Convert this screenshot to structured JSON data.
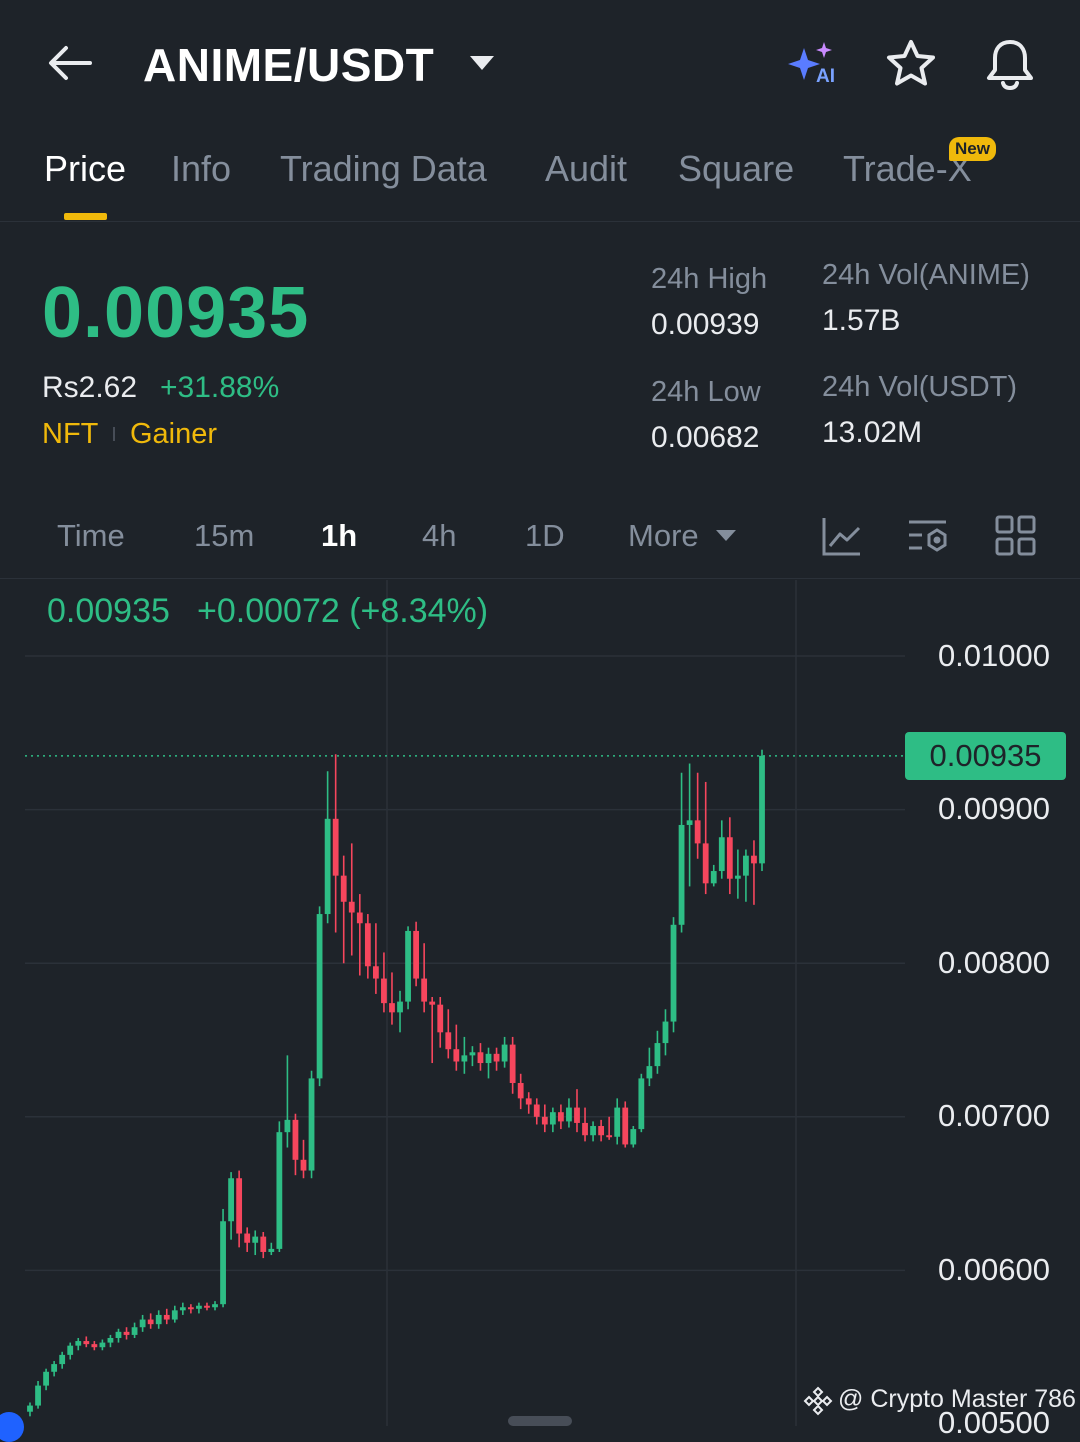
{
  "header": {
    "pair": "ANIME/USDT",
    "icons": [
      "back-arrow-icon",
      "ai-sparkle-icon",
      "star-icon",
      "bell-icon"
    ],
    "ai_badge": "AI"
  },
  "tabs": [
    {
      "label": "Price",
      "active": true
    },
    {
      "label": "Info"
    },
    {
      "label": "Trading Data"
    },
    {
      "label": "Audit"
    },
    {
      "label": "Square"
    },
    {
      "label": "Trade-X",
      "badge": "New"
    }
  ],
  "price": {
    "last": "0.00935",
    "fiat": "Rs2.62",
    "change": "+31.88%",
    "tags": [
      "NFT",
      "Gainer"
    ]
  },
  "stats": {
    "high_label": "24h High",
    "high": "0.00939",
    "low_label": "24h Low",
    "low": "0.00682",
    "vol_base_label": "24h Vol(ANIME)",
    "vol_base": "1.57B",
    "vol_quote_label": "24h Vol(USDT)",
    "vol_quote": "13.02M"
  },
  "intervals": {
    "items": [
      "Time",
      "15m",
      "1h",
      "4h",
      "1D",
      "More"
    ],
    "active": "1h",
    "icons": [
      "chart-indicator-icon",
      "chart-settings-icon",
      "grid-layout-icon"
    ]
  },
  "chart_head": {
    "price": "0.00935",
    "change": "+0.00072 (+8.34%)"
  },
  "watermark": "@ Crypto Master 786",
  "colors": {
    "up": "#2ebd85",
    "down": "#f6465d",
    "accent": "#f0b90b",
    "bg": "#1e2329"
  },
  "chart_data": {
    "type": "candlestick",
    "interval": "1h",
    "y_ticks": [
      "0.01000",
      "0.00900",
      "0.00800",
      "0.00700",
      "0.00600",
      "0.00500"
    ],
    "ylim": [
      0.005,
      0.01
    ],
    "last_price": "0.00935",
    "candles": [
      [
        0.00508,
        0.00512,
        0.00505,
        0.00514
      ],
      [
        0.00512,
        0.00525,
        0.0051,
        0.00528
      ],
      [
        0.00525,
        0.00534,
        0.00522,
        0.00536
      ],
      [
        0.00534,
        0.00539,
        0.00531,
        0.00541
      ],
      [
        0.00539,
        0.00545,
        0.00536,
        0.00547
      ],
      [
        0.00545,
        0.00551,
        0.00542,
        0.00553
      ],
      [
        0.00551,
        0.00554,
        0.00548,
        0.00556
      ],
      [
        0.00554,
        0.00552,
        0.0055,
        0.00557
      ],
      [
        0.00552,
        0.0055,
        0.00548,
        0.00554
      ],
      [
        0.0055,
        0.00553,
        0.00548,
        0.00555
      ],
      [
        0.00553,
        0.00556,
        0.0055,
        0.00558
      ],
      [
        0.00556,
        0.0056,
        0.00553,
        0.00562
      ],
      [
        0.0056,
        0.00558,
        0.00555,
        0.00563
      ],
      [
        0.00558,
        0.00563,
        0.00556,
        0.00566
      ],
      [
        0.00563,
        0.00568,
        0.0056,
        0.00571
      ],
      [
        0.00568,
        0.00565,
        0.00562,
        0.00572
      ],
      [
        0.00565,
        0.00571,
        0.00562,
        0.00574
      ],
      [
        0.00571,
        0.00568,
        0.00565,
        0.00575
      ],
      [
        0.00568,
        0.00574,
        0.00566,
        0.00577
      ],
      [
        0.00574,
        0.00576,
        0.00571,
        0.00579
      ],
      [
        0.00576,
        0.00575,
        0.00572,
        0.00578
      ],
      [
        0.00575,
        0.00577,
        0.00572,
        0.00579
      ],
      [
        0.00577,
        0.00576,
        0.00574,
        0.00579
      ],
      [
        0.00576,
        0.00578,
        0.00574,
        0.0058
      ],
      [
        0.00578,
        0.00632,
        0.00576,
        0.0064
      ],
      [
        0.00632,
        0.0066,
        0.0062,
        0.00664
      ],
      [
        0.0066,
        0.00624,
        0.00615,
        0.00665
      ],
      [
        0.00624,
        0.00618,
        0.00612,
        0.00628
      ],
      [
        0.00618,
        0.00622,
        0.0061,
        0.00626
      ],
      [
        0.00622,
        0.00612,
        0.00608,
        0.00625
      ],
      [
        0.00612,
        0.00614,
        0.0061,
        0.00618
      ],
      [
        0.00614,
        0.0069,
        0.00612,
        0.00697
      ],
      [
        0.0069,
        0.00698,
        0.0068,
        0.0074
      ],
      [
        0.00698,
        0.00672,
        0.00662,
        0.00702
      ],
      [
        0.00672,
        0.00665,
        0.0066,
        0.00685
      ],
      [
        0.00665,
        0.00725,
        0.0066,
        0.0073
      ],
      [
        0.00725,
        0.00832,
        0.0072,
        0.00837
      ],
      [
        0.00832,
        0.00894,
        0.00826,
        0.00925
      ],
      [
        0.00894,
        0.00857,
        0.0082,
        0.00936
      ],
      [
        0.00857,
        0.0084,
        0.008,
        0.0087
      ],
      [
        0.0084,
        0.00833,
        0.00805,
        0.00878
      ],
      [
        0.00833,
        0.00826,
        0.00792,
        0.00845
      ],
      [
        0.00826,
        0.00798,
        0.0079,
        0.00832
      ],
      [
        0.00798,
        0.0079,
        0.0078,
        0.00826
      ],
      [
        0.0079,
        0.00774,
        0.00768,
        0.00807
      ],
      [
        0.00774,
        0.00768,
        0.0076,
        0.00794
      ],
      [
        0.00768,
        0.00775,
        0.00755,
        0.00782
      ],
      [
        0.00775,
        0.00821,
        0.0077,
        0.00824
      ],
      [
        0.00821,
        0.0079,
        0.00785,
        0.00827
      ],
      [
        0.0079,
        0.00775,
        0.00768,
        0.00813
      ],
      [
        0.00775,
        0.00773,
        0.00735,
        0.00778
      ],
      [
        0.00773,
        0.00755,
        0.00745,
        0.00778
      ],
      [
        0.00755,
        0.00744,
        0.00738,
        0.0077
      ],
      [
        0.00744,
        0.00736,
        0.0073,
        0.0076
      ],
      [
        0.00736,
        0.0074,
        0.00728,
        0.00752
      ],
      [
        0.0074,
        0.00742,
        0.00733,
        0.00746
      ],
      [
        0.00742,
        0.00735,
        0.0073,
        0.00748
      ],
      [
        0.00735,
        0.00741,
        0.00725,
        0.00745
      ],
      [
        0.00741,
        0.00736,
        0.0073,
        0.00745
      ],
      [
        0.00736,
        0.00747,
        0.00732,
        0.00752
      ],
      [
        0.00747,
        0.00722,
        0.00715,
        0.00752
      ],
      [
        0.00722,
        0.00712,
        0.00705,
        0.00728
      ],
      [
        0.00712,
        0.00708,
        0.00702,
        0.00716
      ],
      [
        0.00708,
        0.007,
        0.00695,
        0.00712
      ],
      [
        0.007,
        0.00695,
        0.0069,
        0.00708
      ],
      [
        0.00695,
        0.00703,
        0.0069,
        0.00706
      ],
      [
        0.00703,
        0.00697,
        0.00692,
        0.00708
      ],
      [
        0.00697,
        0.00706,
        0.00693,
        0.00712
      ],
      [
        0.00706,
        0.00696,
        0.0069,
        0.00718
      ],
      [
        0.00696,
        0.00688,
        0.00684,
        0.00706
      ],
      [
        0.00688,
        0.00694,
        0.00684,
        0.00697
      ],
      [
        0.00694,
        0.00688,
        0.00684,
        0.00698
      ],
      [
        0.00688,
        0.00687,
        0.00685,
        0.007
      ],
      [
        0.00687,
        0.00706,
        0.00682,
        0.00712
      ],
      [
        0.00706,
        0.00682,
        0.0068,
        0.0071
      ],
      [
        0.00682,
        0.00692,
        0.0068,
        0.00694
      ],
      [
        0.00692,
        0.00725,
        0.0069,
        0.00728
      ],
      [
        0.00725,
        0.00733,
        0.0072,
        0.00745
      ],
      [
        0.00733,
        0.00748,
        0.00728,
        0.00756
      ],
      [
        0.00748,
        0.00762,
        0.0074,
        0.0077
      ],
      [
        0.00762,
        0.00825,
        0.00755,
        0.0083
      ],
      [
        0.00825,
        0.0089,
        0.0082,
        0.00924
      ],
      [
        0.0089,
        0.00893,
        0.0085,
        0.0093
      ],
      [
        0.00893,
        0.00878,
        0.00868,
        0.00924
      ],
      [
        0.00878,
        0.00852,
        0.00845,
        0.00918
      ],
      [
        0.00852,
        0.0086,
        0.0085,
        0.00864
      ],
      [
        0.0086,
        0.00882,
        0.00855,
        0.00893
      ],
      [
        0.00882,
        0.00855,
        0.00845,
        0.00895
      ],
      [
        0.00855,
        0.00857,
        0.00842,
        0.00874
      ],
      [
        0.00857,
        0.0087,
        0.0084,
        0.00874
      ],
      [
        0.0087,
        0.00865,
        0.00838,
        0.0088
      ],
      [
        0.00865,
        0.00935,
        0.0086,
        0.00939
      ]
    ]
  }
}
